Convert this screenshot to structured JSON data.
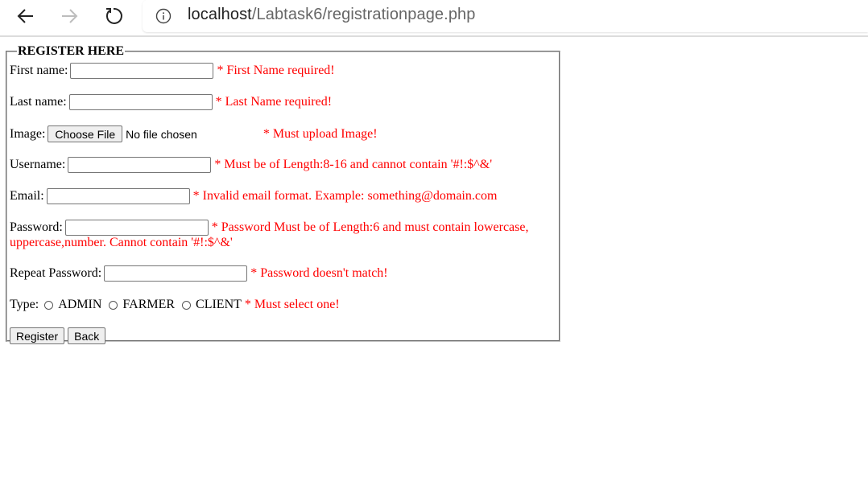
{
  "browser": {
    "url_host": "localhost",
    "url_path": "/Labtask6/registrationpage.php"
  },
  "form": {
    "legend": "REGISTER HERE",
    "first_name": {
      "label": "First name:",
      "value": "",
      "error": "* First Name required!"
    },
    "last_name": {
      "label": "Last name:",
      "value": "",
      "error": "* Last Name required!"
    },
    "image": {
      "label": "Image:",
      "button": "Choose File",
      "status": "No file chosen",
      "error": "* Must upload Image!"
    },
    "username": {
      "label": "Username:",
      "value": "",
      "error": "* Must be of Length:8-16 and cannot contain '#!:$^&'"
    },
    "email": {
      "label": "Email:",
      "value": "",
      "error": "* Invalid email format. Example: something@domain.com"
    },
    "password": {
      "label": "Password:",
      "value": "",
      "error_line1": "* Password Must be of Length:6 and must contain lowercase,",
      "error_line2": "uppercase,number. Cannot contain '#!:$^&'"
    },
    "repeat_password": {
      "label": "Repeat Password:",
      "value": "",
      "error": "* Password doesn't match!"
    },
    "type": {
      "label": "Type:",
      "options": [
        "ADMIN",
        "FARMER",
        "CLIENT"
      ],
      "error": "* Must select one!"
    },
    "buttons": {
      "register": "Register",
      "back": "Back"
    }
  },
  "colors": {
    "error": "#ff0000"
  }
}
